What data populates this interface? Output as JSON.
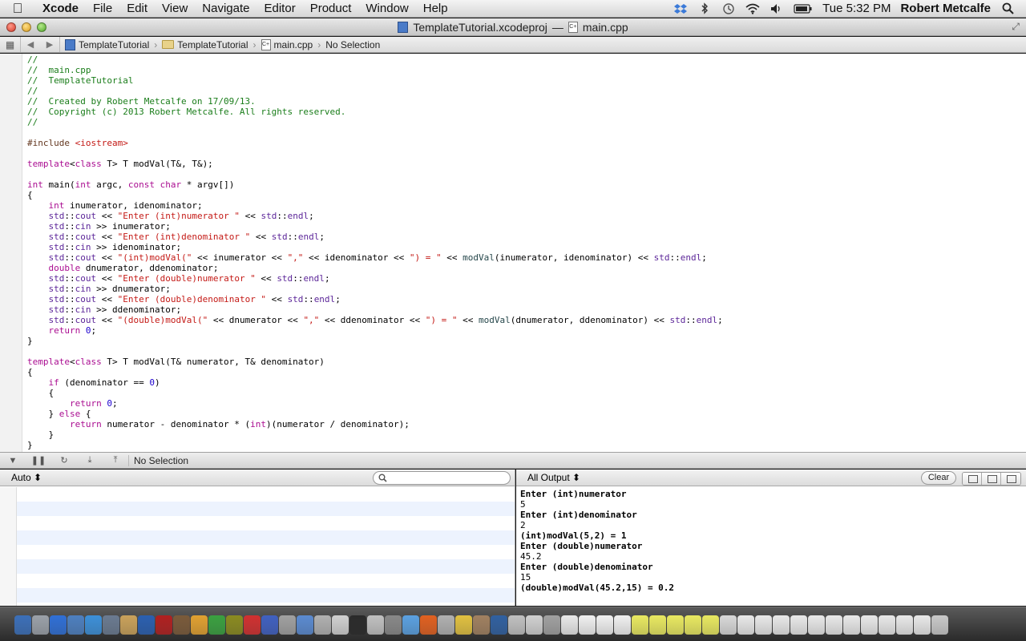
{
  "menubar": {
    "app": "Xcode",
    "items": [
      "File",
      "Edit",
      "View",
      "Navigate",
      "Editor",
      "Product",
      "Window",
      "Help"
    ],
    "clock": "Tue 5:32 PM",
    "user": "Robert Metcalfe",
    "status_icons": [
      "dropbox-icon",
      "bluetooth-icon",
      "time-machine-icon",
      "wifi-icon",
      "volume-icon",
      "battery-icon"
    ]
  },
  "window": {
    "project_title": "TemplateTutorial.xcodeproj",
    "dash": "—",
    "file_title": "main.cpp"
  },
  "jumpbar": {
    "project": "TemplateTutorial",
    "group": "TemplateTutorial",
    "file": "main.cpp",
    "selection": "No Selection"
  },
  "code_lines": [
    [
      [
        "cm",
        "//"
      ]
    ],
    [
      [
        "cm",
        "//  main.cpp"
      ]
    ],
    [
      [
        "cm",
        "//  TemplateTutorial"
      ]
    ],
    [
      [
        "cm",
        "//"
      ]
    ],
    [
      [
        "cm",
        "//  Created by Robert Metcalfe on 17/09/13."
      ]
    ],
    [
      [
        "cm",
        "//  Copyright (c) 2013 Robert Metcalfe. All rights reserved."
      ]
    ],
    [
      [
        "cm",
        "//"
      ]
    ],
    [],
    [
      [
        "pp",
        "#include "
      ],
      [
        "st",
        "<iostream>"
      ]
    ],
    [],
    [
      [
        "kw",
        "template"
      ],
      [
        "",
        "<"
      ],
      [
        "kw",
        "class"
      ],
      [
        "",
        " T> T modVal(T&, T&);"
      ]
    ],
    [],
    [
      [
        "kw",
        "int"
      ],
      [
        "",
        " main("
      ],
      [
        "kw",
        "int"
      ],
      [
        "",
        " argc, "
      ],
      [
        "kw",
        "const"
      ],
      [
        "",
        " "
      ],
      [
        "kw",
        "char"
      ],
      [
        "",
        " * argv[])"
      ]
    ],
    [
      [
        "",
        "{"
      ]
    ],
    [
      [
        "",
        "    "
      ],
      [
        "kw",
        "int"
      ],
      [
        "",
        " inumerator, idenominator;"
      ]
    ],
    [
      [
        "",
        "    "
      ],
      [
        "tp",
        "std"
      ],
      [
        "",
        "::"
      ],
      [
        "tp",
        "cout"
      ],
      [
        "",
        " << "
      ],
      [
        "st",
        "\"Enter (int)numerator \""
      ],
      [
        "",
        " << "
      ],
      [
        "tp",
        "std"
      ],
      [
        "",
        "::"
      ],
      [
        "tp",
        "endl"
      ],
      [
        "",
        ";"
      ]
    ],
    [
      [
        "",
        "    "
      ],
      [
        "tp",
        "std"
      ],
      [
        "",
        "::"
      ],
      [
        "tp",
        "cin"
      ],
      [
        "",
        " >> inumerator;"
      ]
    ],
    [
      [
        "",
        "    "
      ],
      [
        "tp",
        "std"
      ],
      [
        "",
        "::"
      ],
      [
        "tp",
        "cout"
      ],
      [
        "",
        " << "
      ],
      [
        "st",
        "\"Enter (int)denominator \""
      ],
      [
        "",
        " << "
      ],
      [
        "tp",
        "std"
      ],
      [
        "",
        "::"
      ],
      [
        "tp",
        "endl"
      ],
      [
        "",
        ";"
      ]
    ],
    [
      [
        "",
        "    "
      ],
      [
        "tp",
        "std"
      ],
      [
        "",
        "::"
      ],
      [
        "tp",
        "cin"
      ],
      [
        "",
        " >> idenominator;"
      ]
    ],
    [
      [
        "",
        "    "
      ],
      [
        "tp",
        "std"
      ],
      [
        "",
        "::"
      ],
      [
        "tp",
        "cout"
      ],
      [
        "",
        " << "
      ],
      [
        "st",
        "\"(int)modVal(\""
      ],
      [
        "",
        " << inumerator << "
      ],
      [
        "st",
        "\",\""
      ],
      [
        "",
        " << idenominator << "
      ],
      [
        "st",
        "\") = \""
      ],
      [
        "",
        " << "
      ],
      [
        "fn",
        "modVal"
      ],
      [
        "",
        "(inumerator, idenominator) << "
      ],
      [
        "tp",
        "std"
      ],
      [
        "",
        "::"
      ],
      [
        "tp",
        "endl"
      ],
      [
        "",
        ";"
      ]
    ],
    [
      [
        "",
        "    "
      ],
      [
        "kw",
        "double"
      ],
      [
        "",
        " dnumerator, ddenominator;"
      ]
    ],
    [
      [
        "",
        "    "
      ],
      [
        "tp",
        "std"
      ],
      [
        "",
        "::"
      ],
      [
        "tp",
        "cout"
      ],
      [
        "",
        " << "
      ],
      [
        "st",
        "\"Enter (double)numerator \""
      ],
      [
        "",
        " << "
      ],
      [
        "tp",
        "std"
      ],
      [
        "",
        "::"
      ],
      [
        "tp",
        "endl"
      ],
      [
        "",
        ";"
      ]
    ],
    [
      [
        "",
        "    "
      ],
      [
        "tp",
        "std"
      ],
      [
        "",
        "::"
      ],
      [
        "tp",
        "cin"
      ],
      [
        "",
        " >> dnumerator;"
      ]
    ],
    [
      [
        "",
        "    "
      ],
      [
        "tp",
        "std"
      ],
      [
        "",
        "::"
      ],
      [
        "tp",
        "cout"
      ],
      [
        "",
        " << "
      ],
      [
        "st",
        "\"Enter (double)denominator \""
      ],
      [
        "",
        " << "
      ],
      [
        "tp",
        "std"
      ],
      [
        "",
        "::"
      ],
      [
        "tp",
        "endl"
      ],
      [
        "",
        ";"
      ]
    ],
    [
      [
        "",
        "    "
      ],
      [
        "tp",
        "std"
      ],
      [
        "",
        "::"
      ],
      [
        "tp",
        "cin"
      ],
      [
        "",
        " >> ddenominator;"
      ]
    ],
    [
      [
        "",
        "    "
      ],
      [
        "tp",
        "std"
      ],
      [
        "",
        "::"
      ],
      [
        "tp",
        "cout"
      ],
      [
        "",
        " << "
      ],
      [
        "st",
        "\"(double)modVal(\""
      ],
      [
        "",
        " << dnumerator << "
      ],
      [
        "st",
        "\",\""
      ],
      [
        "",
        " << ddenominator << "
      ],
      [
        "st",
        "\") = \""
      ],
      [
        "",
        " << "
      ],
      [
        "fn",
        "modVal"
      ],
      [
        "",
        "(dnumerator, ddenominator) << "
      ],
      [
        "tp",
        "std"
      ],
      [
        "",
        "::"
      ],
      [
        "tp",
        "endl"
      ],
      [
        "",
        ";"
      ]
    ],
    [
      [
        "",
        "    "
      ],
      [
        "kw",
        "return"
      ],
      [
        "",
        " "
      ],
      [
        "nm",
        "0"
      ],
      [
        "",
        ";"
      ]
    ],
    [
      [
        "",
        "}"
      ]
    ],
    [],
    [
      [
        "kw",
        "template"
      ],
      [
        "",
        "<"
      ],
      [
        "kw",
        "class"
      ],
      [
        "",
        " T> T modVal(T& numerator, T& denominator)"
      ]
    ],
    [
      [
        "",
        "{"
      ]
    ],
    [
      [
        "",
        "    "
      ],
      [
        "kw",
        "if"
      ],
      [
        "",
        " (denominator == "
      ],
      [
        "nm",
        "0"
      ],
      [
        "",
        ")"
      ]
    ],
    [
      [
        "",
        "    {"
      ]
    ],
    [
      [
        "",
        "        "
      ],
      [
        "kw",
        "return"
      ],
      [
        "",
        " "
      ],
      [
        "nm",
        "0"
      ],
      [
        "",
        ";"
      ]
    ],
    [
      [
        "",
        "    } "
      ],
      [
        "kw",
        "else"
      ],
      [
        "",
        " {"
      ]
    ],
    [
      [
        "",
        "        "
      ],
      [
        "kw",
        "return"
      ],
      [
        "",
        " numerator - denominator * ("
      ],
      [
        "kw",
        "int"
      ],
      [
        "",
        ")(numerator / denominator);"
      ]
    ],
    [
      [
        "",
        "    }"
      ]
    ],
    [
      [
        "",
        "}"
      ]
    ]
  ],
  "debugbar": {
    "selection": "No Selection"
  },
  "variables_pane": {
    "scope": "Auto ⬍",
    "search_placeholder": ""
  },
  "console": {
    "filter": "All Output ⬍",
    "clear_label": "Clear",
    "lines": [
      {
        "text": "Enter (int)numerator",
        "bold": true
      },
      {
        "text": "5",
        "bold": false
      },
      {
        "text": "Enter (int)denominator",
        "bold": true
      },
      {
        "text": "2",
        "bold": false
      },
      {
        "text": "(int)modVal(5,2) = 1",
        "bold": true
      },
      {
        "text": "Enter (double)numerator",
        "bold": true
      },
      {
        "text": "45.2",
        "bold": false
      },
      {
        "text": "Enter (double)denominator",
        "bold": true
      },
      {
        "text": "15",
        "bold": false
      },
      {
        "text": "(double)modVal(45.2,15) = 0.2",
        "bold": true
      }
    ]
  },
  "dock": {
    "colors": [
      "#3b6fb8",
      "#9aa0a8",
      "#2f6fd6",
      "#4d7fbf",
      "#3c8fd8",
      "#6a7a90",
      "#c9a15a",
      "#2a5fb0",
      "#b02020",
      "#7a5a3a",
      "#e0a030",
      "#3aa040",
      "#8a8a20",
      "#d03030",
      "#4060c0",
      "#a0a0a0",
      "#5a8ad0",
      "#b0b0b0",
      "#d0d0d0",
      "#2a2a2a",
      "#c0c0c0",
      "#888888",
      "#5aa0e0",
      "#e06020",
      "#b0b0b0",
      "#e0c040",
      "#a08060",
      "#3060a0",
      "#c0c0c0",
      "#d0d0d0",
      "#a0a0a0",
      "#e8e8e8",
      "#f0f0f0",
      "#f0f0f0",
      "#f0f0f0",
      "#e8e860",
      "#e8e860",
      "#e8e860",
      "#e8e860",
      "#e8e860",
      "#d8d8d8",
      "#e8e8e8",
      "#e8e8e8",
      "#e8e8e8",
      "#e8e8e8",
      "#e8e8e8",
      "#e8e8e8",
      "#e8e8e8",
      "#e8e8e8",
      "#e8e8e8",
      "#e8e8e8",
      "#e8e8e8",
      "#c8c8c8"
    ]
  }
}
